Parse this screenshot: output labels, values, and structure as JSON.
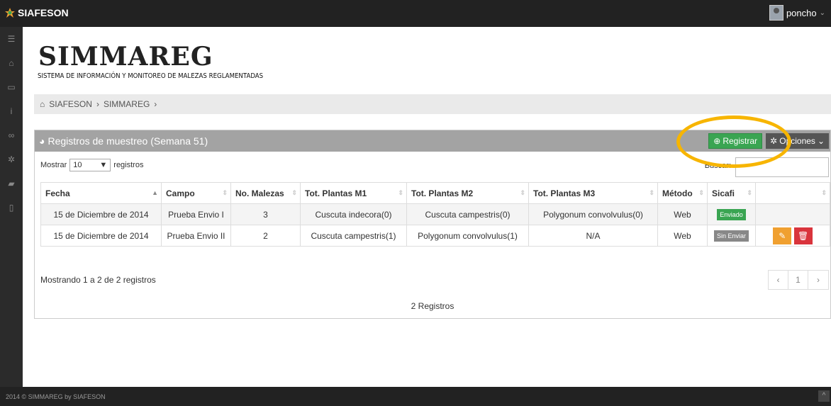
{
  "topbar": {
    "brand": "SIAFESON",
    "user": "poncho"
  },
  "sidebar": {
    "icons": [
      "menu-icon",
      "home-icon",
      "folder-icon",
      "info-icon",
      "link-icon",
      "gear-icon",
      "book-icon",
      "document-icon"
    ]
  },
  "header": {
    "title": "SIMMAREG",
    "subtitle": "SISTEMA DE INFORMACIÓN Y MONITOREO DE MALEZAS REGLAMENTADAS"
  },
  "breadcrumb": {
    "items": [
      "SIAFESON",
      "SIMMAREG"
    ]
  },
  "panel": {
    "title": "Registros de muestreo (Semana 51)",
    "registrar_label": "Registrar",
    "opciones_label": "Opciones",
    "show_label": "Mostrar",
    "page_length": "10",
    "records_label": "registros",
    "search_label": "Buscar:"
  },
  "table": {
    "headers": [
      "Fecha",
      "Campo",
      "No. Malezas",
      "Tot. Plantas M1",
      "Tot. Plantas M2",
      "Tot. Plantas M3",
      "Método",
      "Sicafi",
      ""
    ],
    "rows": [
      {
        "fecha": "15 de Diciembre de 2014",
        "campo": "Prueba Envio I",
        "malezas": "3",
        "m1": "Cuscuta indecora(0)",
        "m2": "Cuscuta campestris(0)",
        "m3": "Polygonum convolvulus(0)",
        "metodo": "Web",
        "sicafi": "Enviado"
      },
      {
        "fecha": "15 de Diciembre de 2014",
        "campo": "Prueba Envio II",
        "malezas": "2",
        "m1": "Cuscuta campestris(1)",
        "m2": "Polygonum convolvulus(1)",
        "m3": "N/A",
        "metodo": "Web",
        "sicafi": "Sin Enviar"
      }
    ]
  },
  "info": "Mostrando 1 a 2 de 2 registros",
  "pager": {
    "prev": "‹",
    "current": "1",
    "next": "›"
  },
  "total": "2 Registros",
  "footer": "2014 © SIMMAREG by SIAFESON",
  "colors": {
    "registrar": "#3aa552",
    "edit": "#f0a030",
    "delete": "#d9343c",
    "highlight": "#f7b500"
  }
}
